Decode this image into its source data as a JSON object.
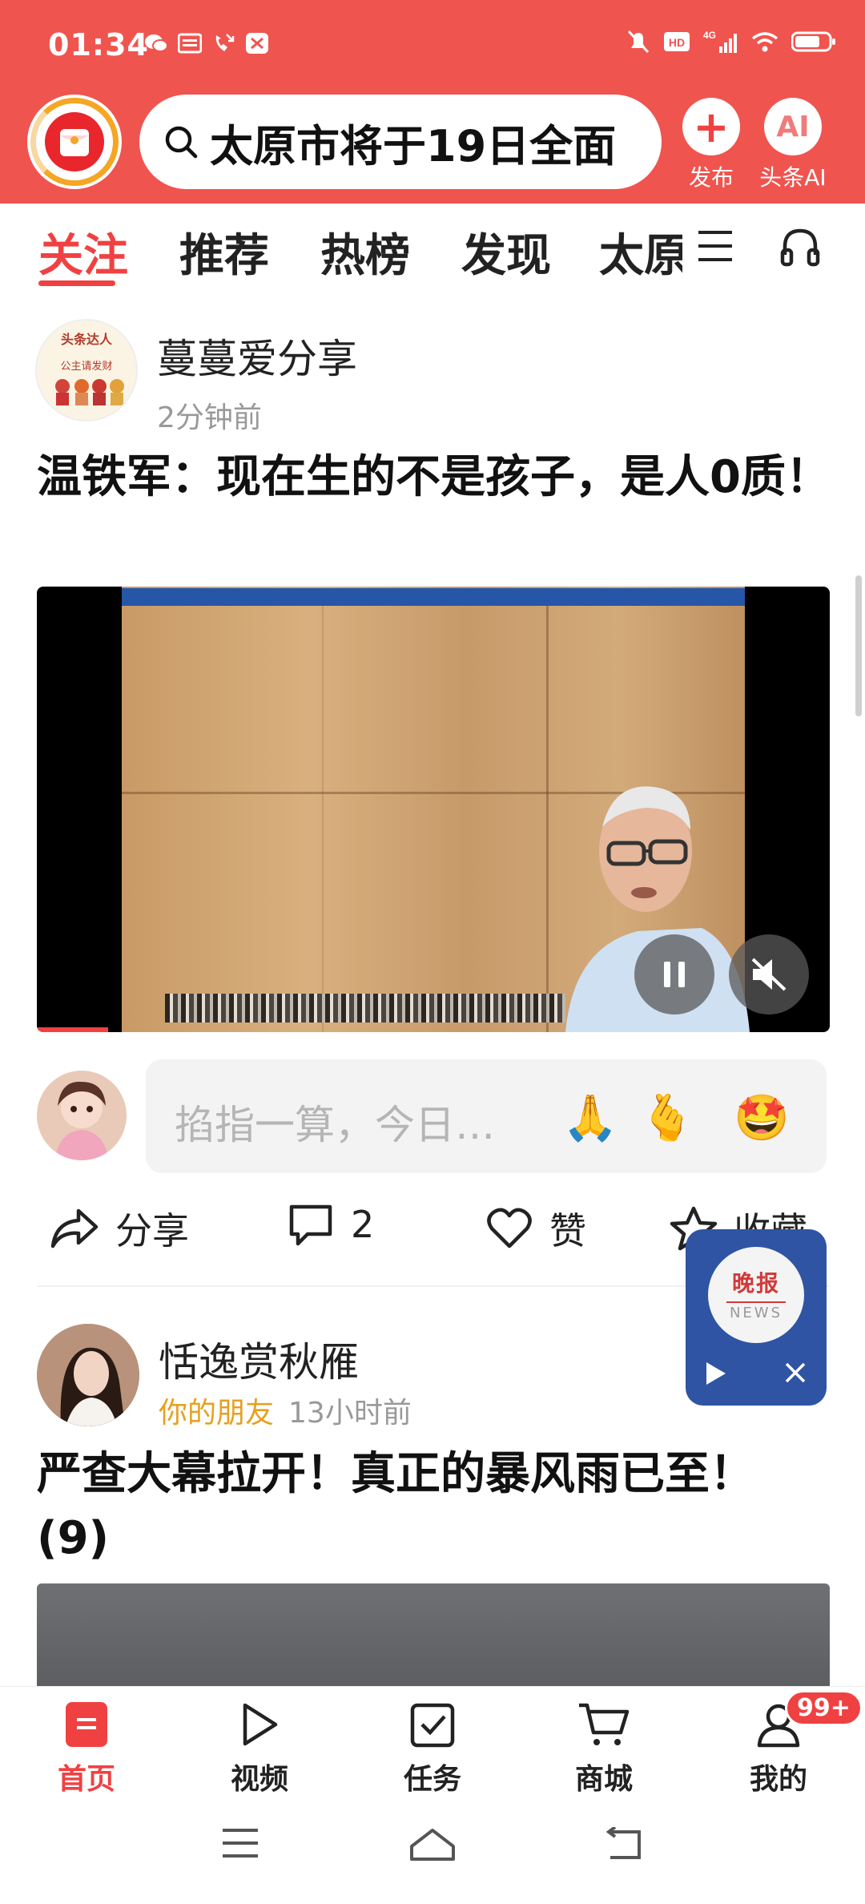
{
  "status_bar": {
    "time": "01:34",
    "network": "4G"
  },
  "header": {
    "search_text": "太原市将于19日全面",
    "publish_label": "发布",
    "publish_symbol": "+",
    "ai_label": "头条AI",
    "ai_symbol": "AI"
  },
  "tabs": [
    {
      "label": "关注",
      "active": true
    },
    {
      "label": "推荐"
    },
    {
      "label": "热榜"
    },
    {
      "label": "发现"
    },
    {
      "label": "太原"
    }
  ],
  "post1": {
    "author": "蔓蔓爱分享",
    "avatar_text_top": "头条达人",
    "avatar_text_mid": "公主请发财",
    "time": "2分钟前",
    "title": "温铁军：现在生的不是孩子，是人0质！",
    "comment_placeholder": "掐指一算，今日…",
    "emojis": [
      "🙏",
      "🫰",
      "🤩"
    ],
    "share_label": "分享",
    "comment_count": "2",
    "like_label": "赞",
    "fav_label": "收藏",
    "video_progress": 0.09
  },
  "float_news": {
    "title": "晚报",
    "subtitle": "NEWS"
  },
  "post2": {
    "author": "恬逸赏秋雁",
    "relation": "你的朋友",
    "time": "13小时前",
    "title": "严查大幕拉开！真正的暴风雨已至！ (9)"
  },
  "bottom_nav": [
    {
      "label": "首页",
      "active": true
    },
    {
      "label": "视频"
    },
    {
      "label": "任务"
    },
    {
      "label": "商城"
    },
    {
      "label": "我的",
      "badge": "99+"
    }
  ],
  "colors": {
    "brand_red": "#f04142",
    "header_bg": "#f0544f",
    "friend_tag": "#e6a020",
    "news_widget": "#2f54a3"
  }
}
